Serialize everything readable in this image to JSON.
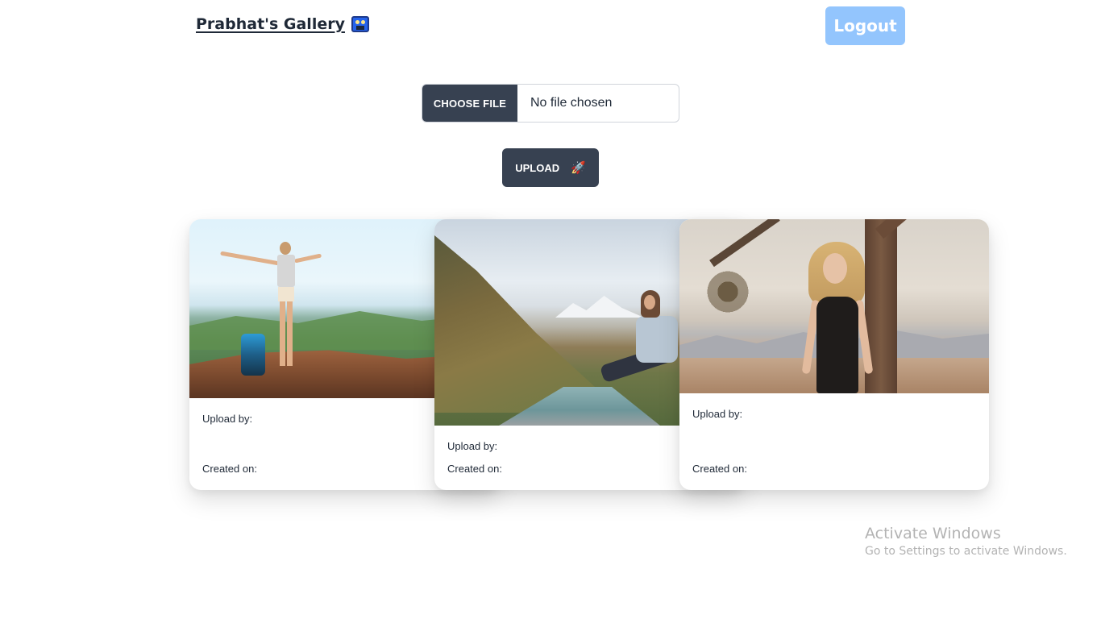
{
  "header": {
    "brand_title": "Prabhat's Gallery",
    "brand_icon": "movie-camera-icon",
    "logout_label": "Logout"
  },
  "upload_form": {
    "choose_file_label": "CHOOSE FILE",
    "file_status": "No file chosen",
    "upload_label": "UPLOAD",
    "upload_icon": "rocket-icon"
  },
  "gallery": {
    "cards": [
      {
        "image": "hiker-on-mountain-photo",
        "upload_by_label": "Upload by:",
        "created_on_label": "Created on:"
      },
      {
        "image": "woman-in-mountain-valley-photo",
        "upload_by_label": "Upload by:",
        "created_on_label": "Created on:"
      },
      {
        "image": "woman-in-desert-photo",
        "upload_by_label": "Upload by:",
        "created_on_label": "Created on:"
      }
    ]
  },
  "watermark": {
    "title": "Activate Windows",
    "subtitle": "Go to Settings to activate Windows."
  }
}
